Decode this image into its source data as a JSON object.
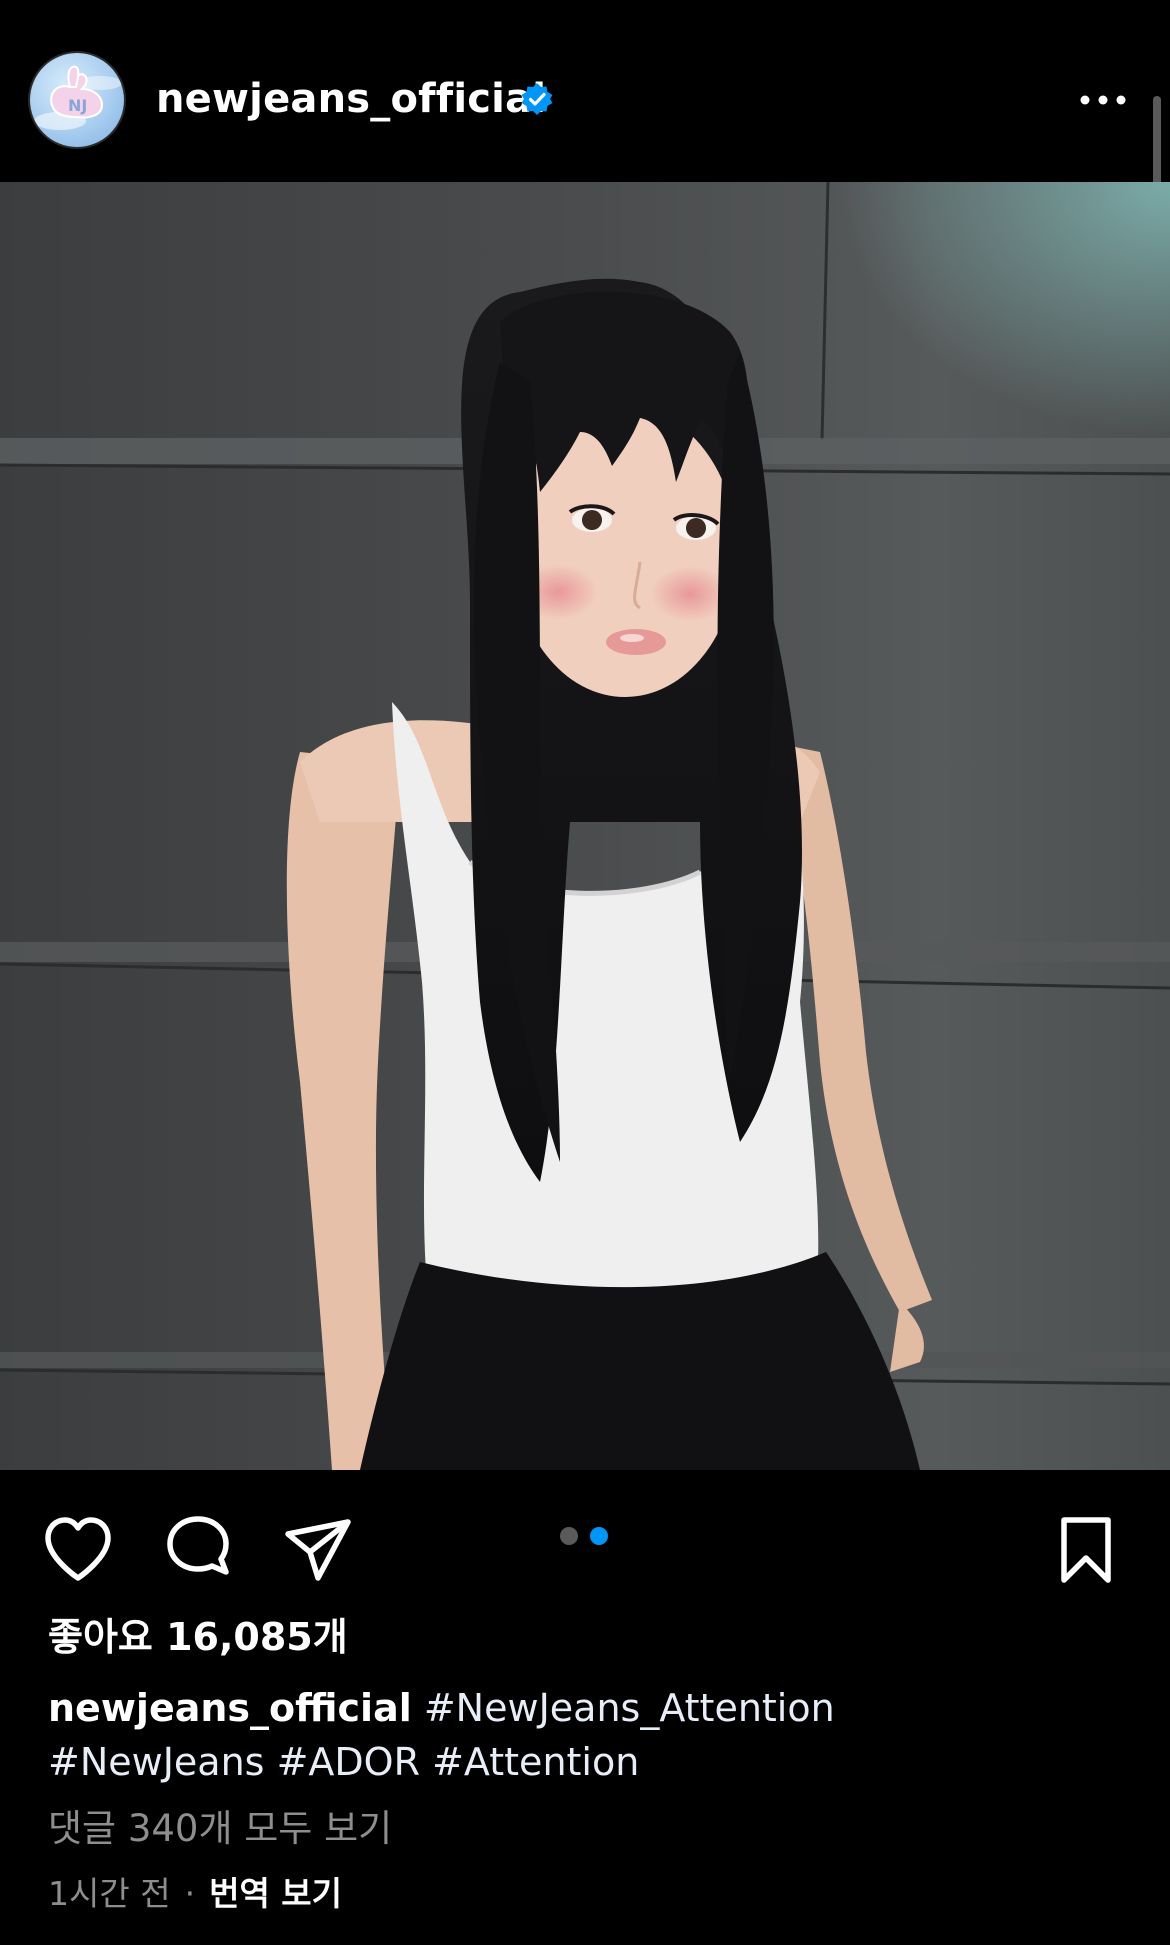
{
  "post": {
    "username": "newjeans_official",
    "verified": true,
    "avatar_text": "NJ",
    "avatar_icon": "bunny-logo-avatar",
    "more_icon": "more-horizontal-icon",
    "photo_icon": "post-photo",
    "carousel": {
      "total": 2,
      "active": 2
    },
    "actions": {
      "like_icon": "heart-icon",
      "comment_icon": "comment-bubble-icon",
      "share_icon": "paper-plane-icon",
      "save_icon": "bookmark-icon"
    },
    "likes_text": "좋아요 16,085개",
    "caption": {
      "username": "newjeans_official",
      "tags": [
        "#NewJeans_Attention",
        "#NewJeans",
        "#ADOR",
        "#Attention"
      ]
    },
    "comments_link": "댓글 340개 모두 보기",
    "time": "1시간 전",
    "separator": "·",
    "translate_link": "번역 보기"
  },
  "colors": {
    "background": "#000000",
    "verified_badge": "#0095f6",
    "carousel_active": "#0095f6",
    "carousel_inactive": "#5a5a5a",
    "secondary_text": "#8e8e8e"
  }
}
